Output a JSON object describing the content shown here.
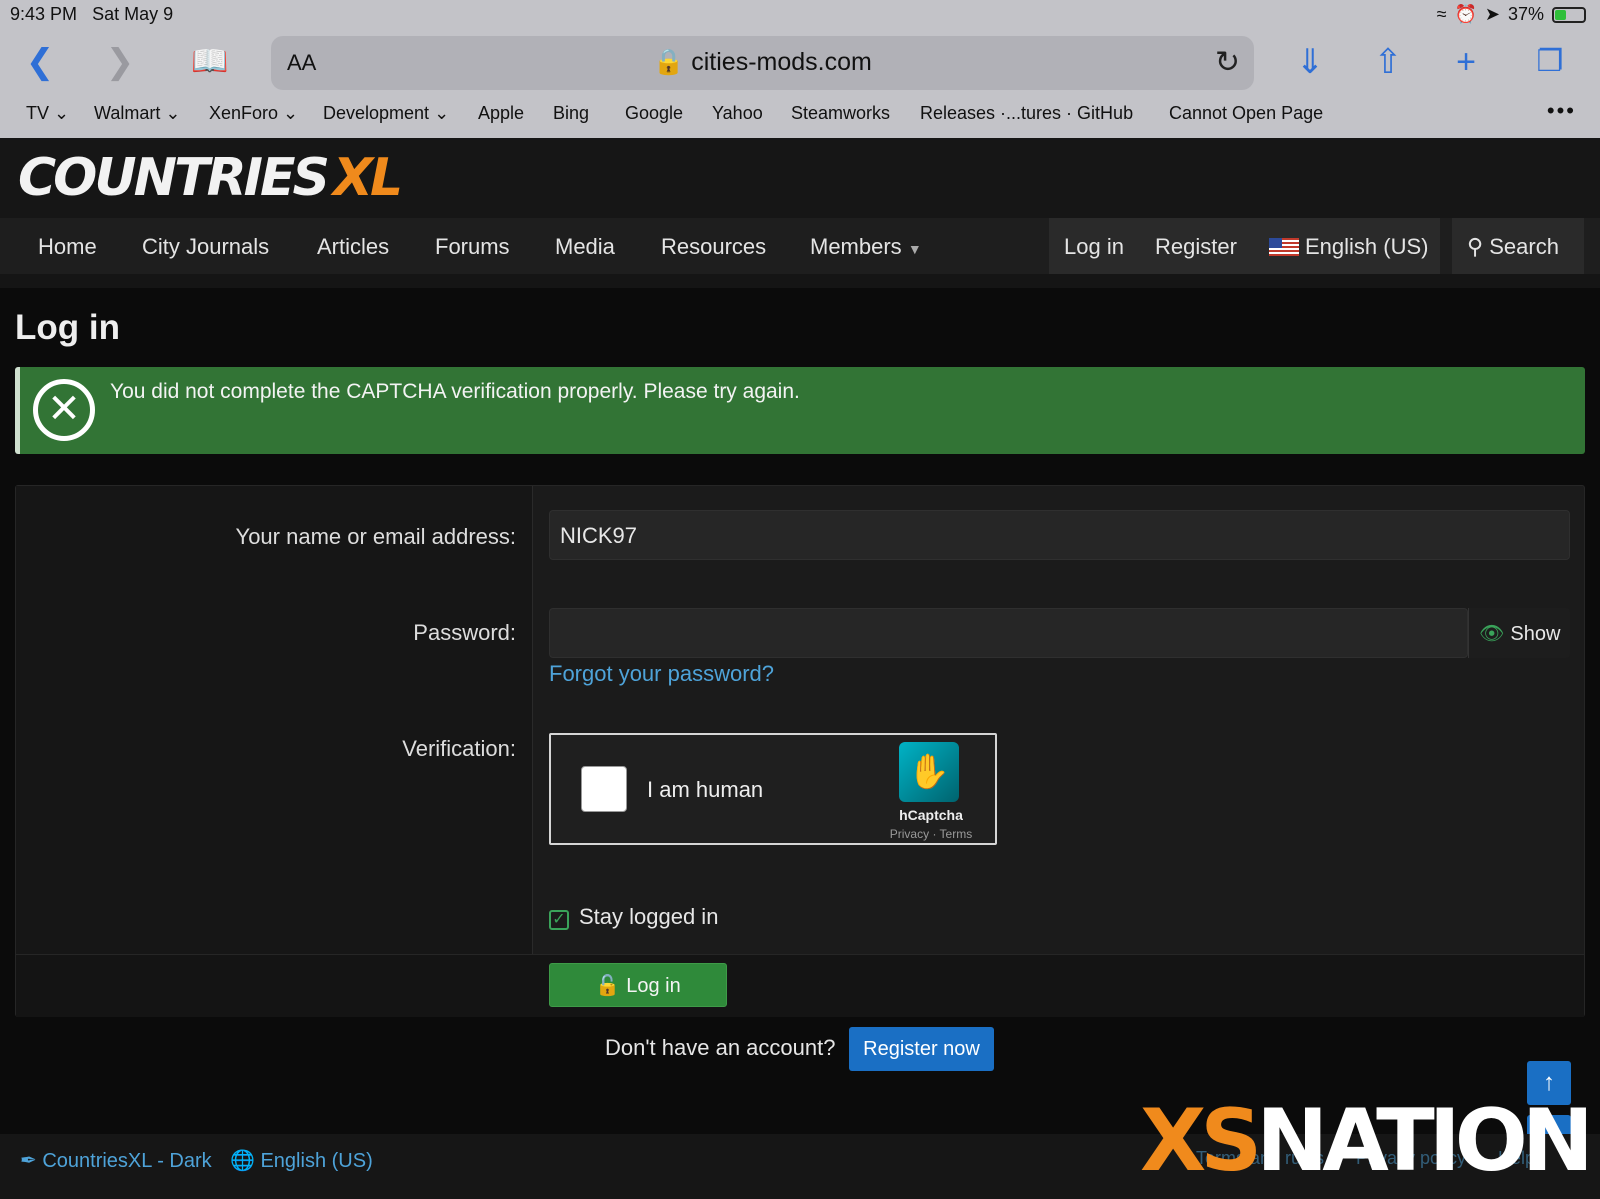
{
  "status_bar": {
    "time": "9:43 PM",
    "date": "Sat May 9",
    "battery": "37%"
  },
  "browser": {
    "aa_label": "AA",
    "url_host": "cities-mods.com",
    "bookmarks": [
      "TV",
      "Walmart",
      "XenForo",
      "Development",
      "Apple",
      "Bing",
      "Google",
      "Yahoo",
      "Steamworks",
      "Releases ·...tures · GitHub",
      "Cannot Open Page"
    ],
    "more": "•••"
  },
  "site": {
    "logo_main": "COUNTRIES",
    "logo_accent": "XL"
  },
  "nav": {
    "items": [
      "Home",
      "City Journals",
      "Articles",
      "Forums",
      "Media",
      "Resources",
      "Members"
    ],
    "login": "Log in",
    "register": "Register",
    "language": "English (US)",
    "search": "Search"
  },
  "page": {
    "title": "Log in",
    "error": "You did not complete the CAPTCHA verification properly. Please try again."
  },
  "form": {
    "name_label": "Your name or email address:",
    "name_value": "NICK97",
    "password_label": "Password:",
    "password_value": "",
    "show_label": "Show",
    "forgot": "Forgot your password?",
    "verification_label": "Verification:",
    "captcha_text": "I am human",
    "captcha_brand": "hCaptcha",
    "captcha_links": "Privacy · Terms",
    "stay_logged_in": "Stay logged in",
    "stay_checked": true,
    "login_button": "Log in"
  },
  "register": {
    "question": "Don't have an account?",
    "button": "Register now"
  },
  "footer": {
    "style": "CountriesXL - Dark",
    "language": "English (US)",
    "terms": "Terms and rules",
    "privacy": "Privacy policy",
    "help": "Help"
  },
  "watermark": {
    "accent": "XS",
    "main": "NATION"
  },
  "colors": {
    "success_green": "#327435",
    "button_green": "#2f8a3a",
    "link_blue": "#4ea3d9",
    "primary_blue": "#1a6fc4",
    "logo_orange": "#f08a1c"
  }
}
